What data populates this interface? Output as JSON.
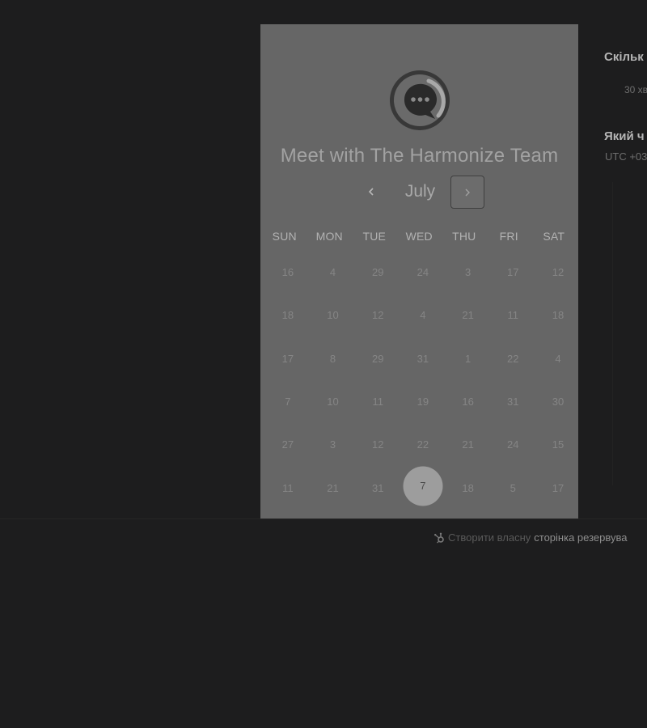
{
  "card": {
    "title": "Meet with The Harmonize Team",
    "month": "July",
    "weekdays": [
      "SUN",
      "MON",
      "TUE",
      "WED",
      "THU",
      "FRI",
      "SAT"
    ],
    "days": [
      [
        "16",
        "4",
        "29",
        "24",
        "3",
        "17",
        "12"
      ],
      [
        "18",
        "10",
        "12",
        "4",
        "21",
        "11",
        "18"
      ],
      [
        "17",
        "8",
        "29",
        "31",
        "1",
        "22",
        "4"
      ],
      [
        "7",
        "10",
        "11",
        "19",
        "16",
        "31",
        "30"
      ],
      [
        "27",
        "3",
        "12",
        "22",
        "21",
        "24",
        "15"
      ],
      [
        "11",
        "21",
        "31",
        "7",
        "18",
        "5",
        "17"
      ]
    ],
    "selected_day": "7"
  },
  "side": {
    "title_1": "Скільк",
    "duration": "30 хв",
    "title_2": "Який ч",
    "timezone": "UTC +03"
  },
  "footer": {
    "plain_text": "Створити власну",
    "link_text": "сторінка резервува"
  },
  "colors": {
    "background": "#1d1d1e",
    "card": "#666666",
    "selected_circle": "#9d9d9d"
  },
  "icons": {
    "logo": "chat-bubble-logo-icon",
    "prev": "chevron-left-icon",
    "next": "chevron-right-icon",
    "footer": "hubspot-sprocket-icon"
  }
}
